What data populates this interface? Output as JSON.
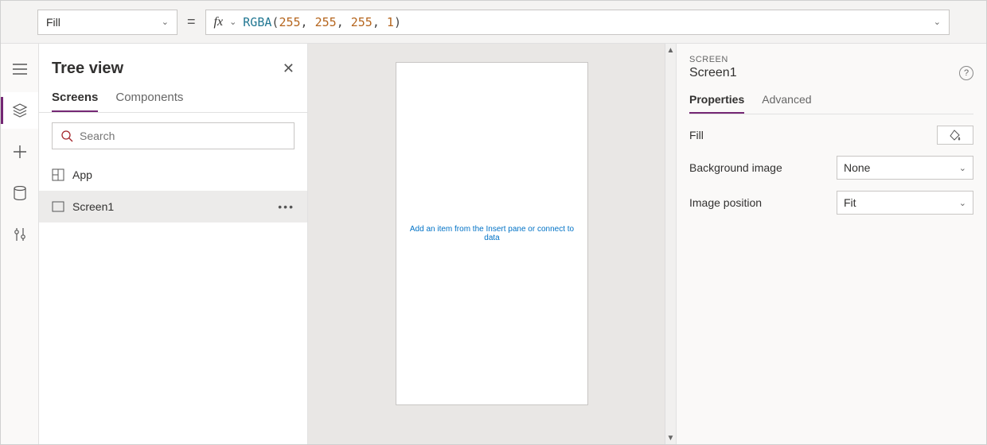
{
  "formula_bar": {
    "property": "Fill",
    "equals": "=",
    "fx_label": "fx",
    "formula_fn": "RGBA",
    "formula_args": [
      "255",
      "255",
      "255",
      "1"
    ]
  },
  "tree": {
    "title": "Tree view",
    "tabs": {
      "screens": "Screens",
      "components": "Components"
    },
    "search_placeholder": "Search",
    "items": [
      {
        "label": "App"
      },
      {
        "label": "Screen1"
      }
    ]
  },
  "canvas": {
    "hint": "Add an item from the Insert pane or connect to data"
  },
  "right": {
    "section": "SCREEN",
    "name": "Screen1",
    "tabs": {
      "properties": "Properties",
      "advanced": "Advanced"
    },
    "rows": {
      "fill": "Fill",
      "bgimg": "Background image",
      "bgimg_value": "None",
      "imgpos": "Image position",
      "imgpos_value": "Fit"
    }
  }
}
